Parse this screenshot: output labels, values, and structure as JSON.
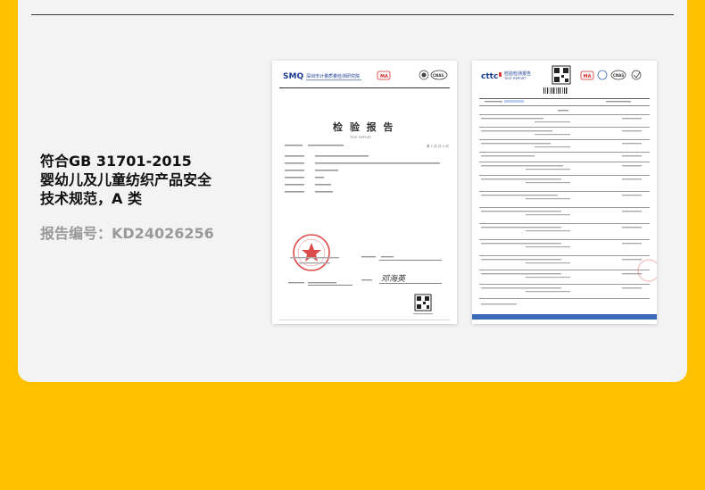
{
  "title": {
    "line1": "符合GB 31701-2015",
    "line2": "婴幼儿及儿童纺织产品安全",
    "line3": "技术规范，A 类"
  },
  "report_number": {
    "text": "报告编号：KD24026256"
  },
  "cert1": {
    "org_logo": "SMQ",
    "org_name": "深圳市计量质量检测研究院",
    "cma": "MA",
    "cnas": "CNAS",
    "heading": "检 验 报 告",
    "subheading": "TEST REPORT",
    "page_info": "第 1 页 共 4 页",
    "signature": "邓海英",
    "accent_color": "#1a3d8f",
    "seal_color": "#d62b2b"
  },
  "cert2": {
    "org_logo": "cttc",
    "org_name": "检验检测报告",
    "org_name_en": "TEST REPORT",
    "cma": "MA",
    "cnas": "CNAS",
    "accent_color": "#1a3d8f",
    "brand_red": "#e23b3b",
    "stamp_color": "#e06060"
  }
}
